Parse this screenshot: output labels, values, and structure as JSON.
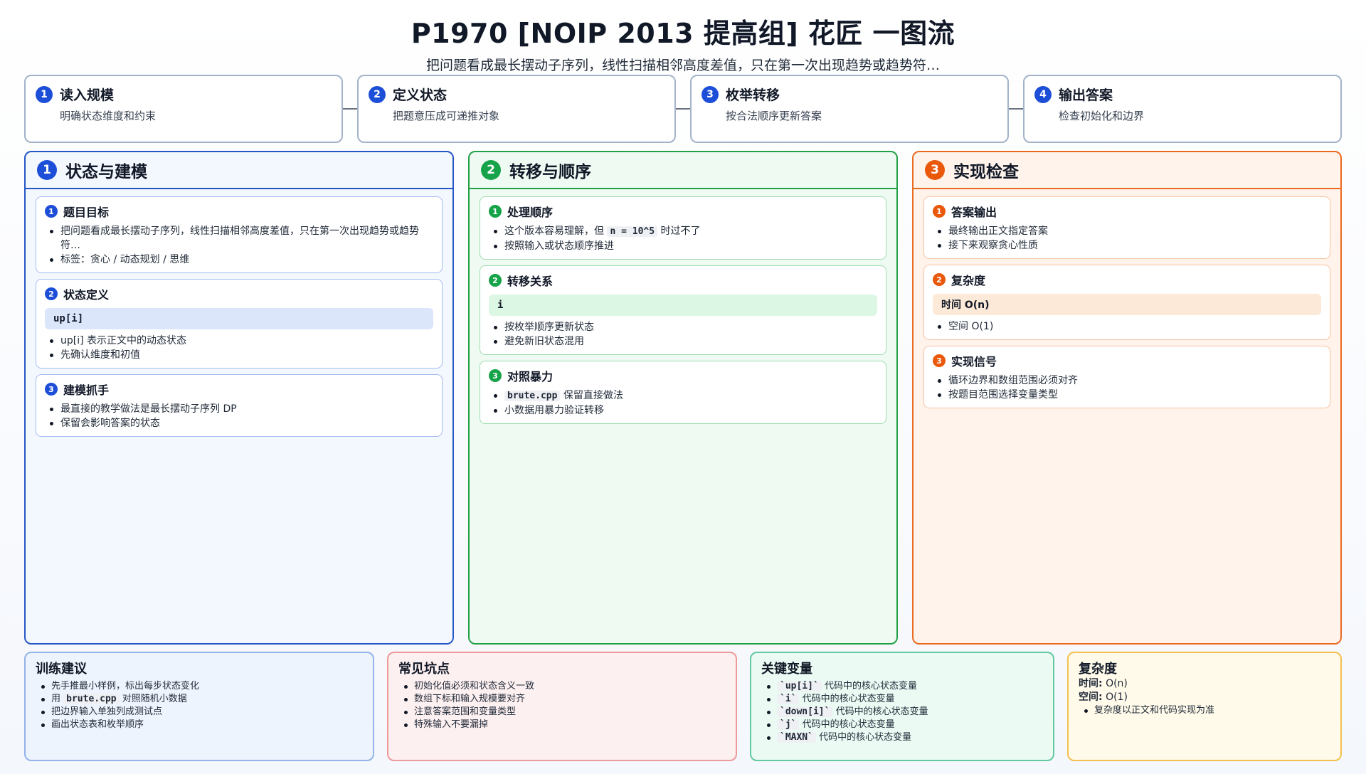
{
  "header": {
    "title": "P1970 [NOIP 2013 提高组] 花匠 一图流",
    "subtitle": "把问题看成最长摆动子序列，线性扫描相邻高度差值，只在第一次出现趋势或趋势符…"
  },
  "steps": [
    {
      "num": "1",
      "title": "读入规模",
      "desc": "明确状态维度和约束"
    },
    {
      "num": "2",
      "title": "定义状态",
      "desc": "把题意压成可递推对象"
    },
    {
      "num": "3",
      "title": "枚举转移",
      "desc": "按合法顺序更新答案"
    },
    {
      "num": "4",
      "title": "输出答案",
      "desc": "检查初始化和边界"
    }
  ],
  "columns": {
    "c1": {
      "num": "1",
      "title": "状态与建模",
      "cards": [
        {
          "num": "1",
          "title": "题目目标",
          "items": [
            "把问题看成最长摆动子序列，线性扫描相邻高度差值，只在第一次出现趋势或趋势符…",
            "标签：贪心 / 动态规划 / 思维"
          ]
        },
        {
          "num": "2",
          "title": "状态定义",
          "code": "up[i]",
          "items": [
            "up[i] 表示正文中的动态状态",
            "先确认维度和初值"
          ]
        },
        {
          "num": "3",
          "title": "建模抓手",
          "items": [
            "最直接的教学做法是最长摆动子序列 DP",
            "保留会影响答案的状态"
          ]
        }
      ]
    },
    "c2": {
      "num": "2",
      "title": "转移与顺序",
      "cards": [
        {
          "num": "1",
          "title": "处理顺序",
          "item1_pre": "这个版本容易理解，但",
          "item1_code": "n = 10^5",
          "item1_post": "时过不了",
          "item2": "按照输入或状态顺序推进"
        },
        {
          "num": "2",
          "title": "转移关系",
          "code": "i",
          "items": [
            "按枚举顺序更新状态",
            "避免新旧状态混用"
          ]
        },
        {
          "num": "3",
          "title": "对照暴力",
          "item1_code": "brute.cpp",
          "item1_post": "保留直接做法",
          "item2": "小数据用暴力验证转移"
        }
      ]
    },
    "c3": {
      "num": "3",
      "title": "实现检查",
      "cards": [
        {
          "num": "1",
          "title": "答案输出",
          "items": [
            "最终输出正文指定答案",
            "接下来观察贪心性质"
          ]
        },
        {
          "num": "2",
          "title": "复杂度",
          "code": "时间 O(n)",
          "items": [
            "空间 O(1)"
          ]
        },
        {
          "num": "3",
          "title": "实现信号",
          "items": [
            "循环边界和数组范围必须对齐",
            "按题目范围选择变量类型"
          ]
        }
      ]
    }
  },
  "panels": {
    "training": {
      "title": "训练建议",
      "item1": "先手推最小样例，标出每步状态变化",
      "item2_pre": "用",
      "item2_code": "brute.cpp",
      "item2_post": "对照随机小数据",
      "item3": "把边界输入单独列成测试点",
      "item4": "画出状态表和枚举顺序"
    },
    "pitfalls": {
      "title": "常见坑点",
      "items": [
        "初始化值必须和状态含义一致",
        "数组下标和输入规模要对齐",
        "注意答案范围和变量类型",
        "特殊输入不要漏掉"
      ]
    },
    "vars": {
      "title": "关键变量",
      "items": [
        {
          "code": "`up[i]`",
          "desc": "代码中的核心状态变量"
        },
        {
          "code": "`i`",
          "desc": "代码中的核心状态变量"
        },
        {
          "code": "`down[i]`",
          "desc": "代码中的核心状态变量"
        },
        {
          "code": "`j`",
          "desc": "代码中的核心状态变量"
        },
        {
          "code": "`MAXN`",
          "desc": "代码中的核心状态变量"
        }
      ]
    },
    "complexity": {
      "title": "复杂度",
      "time_label": "时间:",
      "time_value": "O(n)",
      "space_label": "空间:",
      "space_value": "O(1)",
      "note": "复杂度以正文和代码实现为准"
    }
  }
}
